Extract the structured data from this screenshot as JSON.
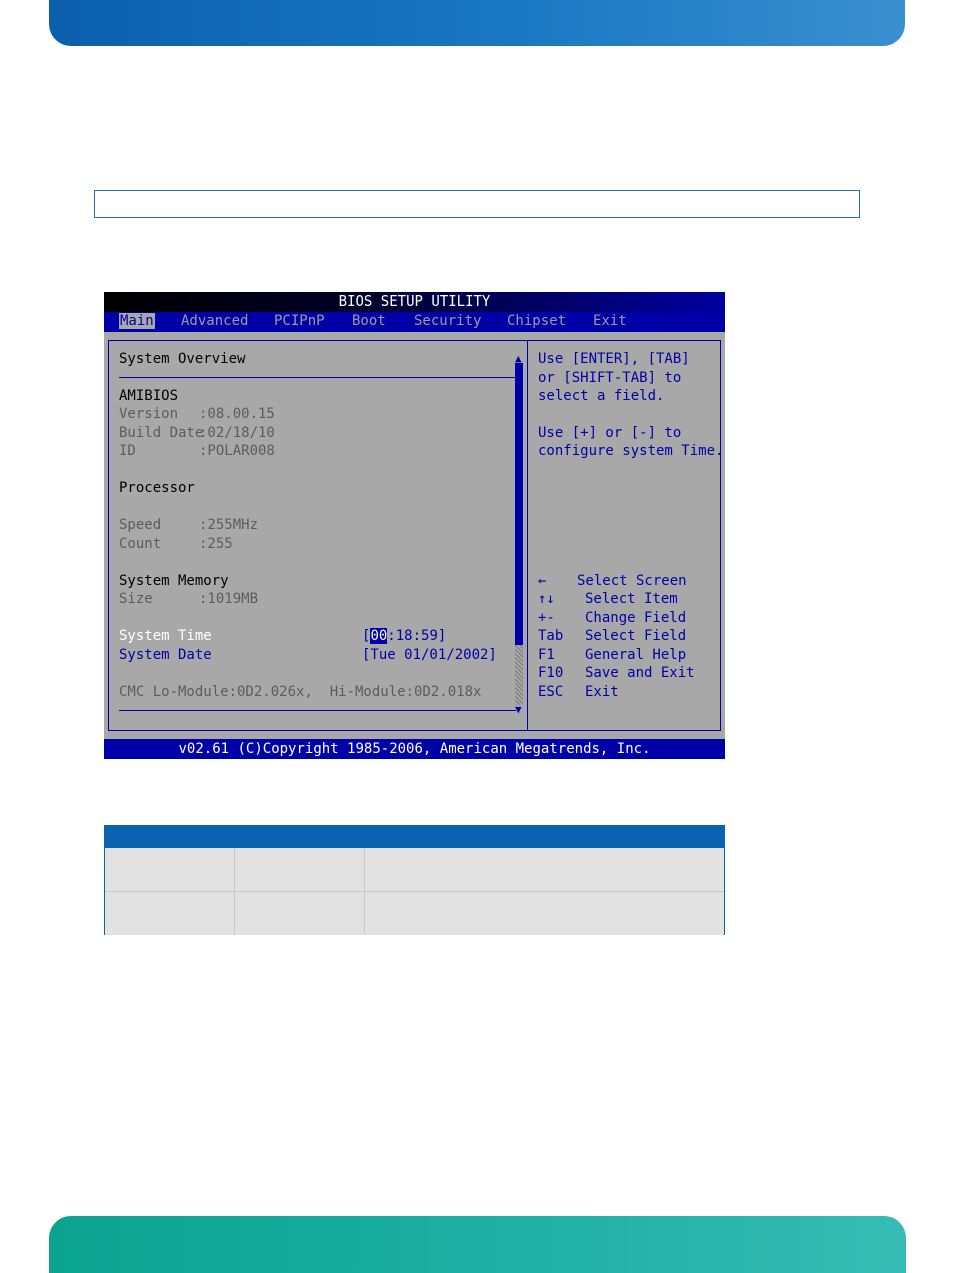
{
  "bios": {
    "title": "BIOS SETUP UTILITY",
    "menu": [
      "Main",
      "Advanced",
      "PCIPnP",
      "Boot",
      "Security",
      "Chipset",
      "Exit"
    ],
    "active_menu": "Main",
    "overview": {
      "heading": "System Overview",
      "amibios": {
        "heading": "AMIBIOS",
        "rows": [
          {
            "label": "Version",
            "value": ":08.00.15"
          },
          {
            "label": "Build Date",
            "value": ":02/18/10"
          },
          {
            "label": "ID",
            "value": ":POLAR008"
          }
        ]
      },
      "processor": {
        "heading": "Processor",
        "rows": [
          {
            "label": "Speed",
            "value": ":255MHz"
          },
          {
            "label": "Count",
            "value": ":255"
          }
        ]
      },
      "memory": {
        "heading": "System Memory",
        "rows": [
          {
            "label": "Size",
            "value": ":1019MB"
          }
        ]
      },
      "time": {
        "label": "System Time",
        "bracket_open": "[",
        "hour": "00",
        "rest": ":18:59]"
      },
      "date": {
        "label": "System Date",
        "value": "[Tue 01/01/2002]"
      },
      "cmc": "CMC Lo-Module:0D2.026x,  Hi-Module:0D2.018x"
    },
    "help": [
      "Use [ENTER], [TAB]",
      "or [SHIFT-TAB] to",
      "select a field.",
      "",
      "Use [+] or [-] to",
      "configure system Time."
    ],
    "keys": [
      {
        "key": "←",
        "desc": "Select Screen"
      },
      {
        "key": "↑↓",
        "desc": "Select Item"
      },
      {
        "key": "+-",
        "desc": "Change Field"
      },
      {
        "key": "Tab",
        "desc": "Select Field"
      },
      {
        "key": "F1",
        "desc": "General Help"
      },
      {
        "key": "F10",
        "desc": "Save and Exit"
      },
      {
        "key": "ESC",
        "desc": "Exit"
      }
    ],
    "footer": "v02.61 (C)Copyright 1985-2006, American Megatrends, Inc."
  },
  "colors": {
    "bios_blue": "#0000a8",
    "bios_gray": "#a8a8a8",
    "top_band": "#1a78c2",
    "bottom_band": "#1fb0a5",
    "table_header": "#0a63b0"
  }
}
